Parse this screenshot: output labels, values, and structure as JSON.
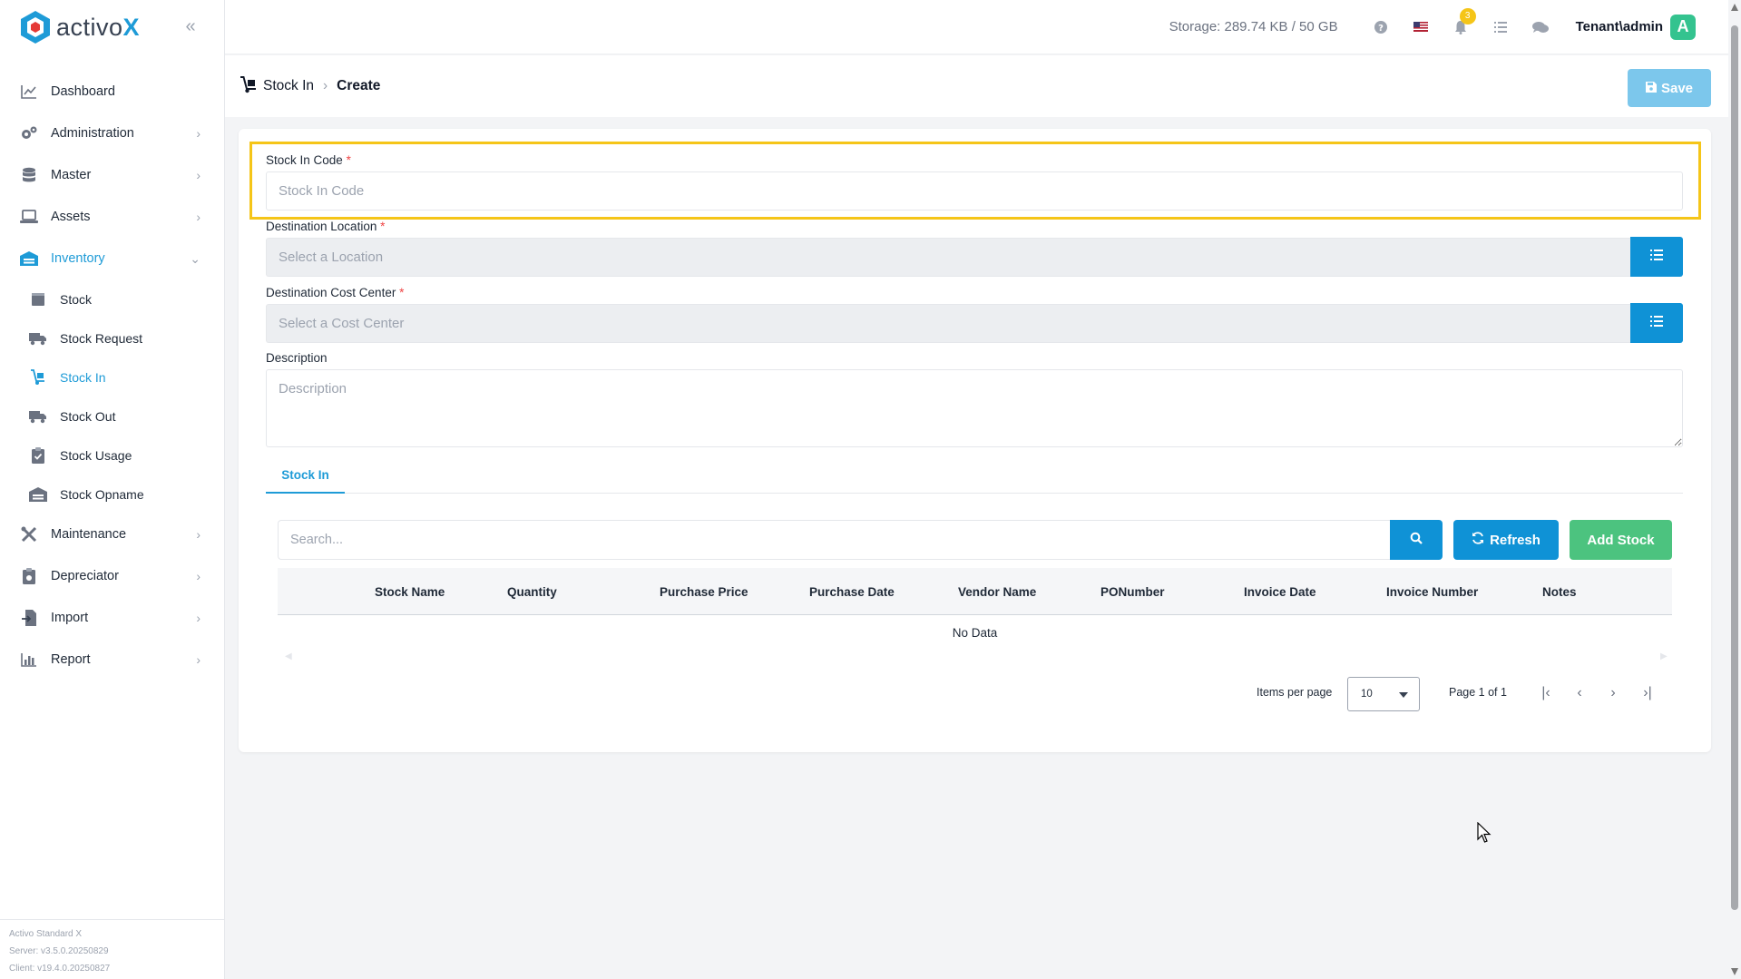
{
  "app": {
    "logo_text": "activo",
    "logo_x": "X",
    "brand_color": "#1e9bd7"
  },
  "sidebar": {
    "items": [
      {
        "label": "Dashboard",
        "icon": "chart-line-icon",
        "has_chevron": false
      },
      {
        "label": "Administration",
        "icon": "gears-icon",
        "has_chevron": true
      },
      {
        "label": "Master",
        "icon": "database-icon",
        "has_chevron": true
      },
      {
        "label": "Assets",
        "icon": "laptop-icon",
        "has_chevron": true
      },
      {
        "label": "Inventory",
        "icon": "warehouse-icon",
        "has_chevron": true,
        "expanded": true
      }
    ],
    "inventory_sub": [
      {
        "label": "Stock",
        "icon": "box-icon"
      },
      {
        "label": "Stock Request",
        "icon": "truck-icon"
      },
      {
        "label": "Stock In",
        "icon": "dolly-icon",
        "active": true
      },
      {
        "label": "Stock Out",
        "icon": "truck-out-icon"
      },
      {
        "label": "Stock Usage",
        "icon": "clipboard-check-icon"
      },
      {
        "label": "Stock Opname",
        "icon": "warehouse-check-icon"
      }
    ],
    "items_after": [
      {
        "label": "Maintenance",
        "icon": "tools-icon"
      },
      {
        "label": "Depreciator",
        "icon": "clipboard-dollar-icon"
      },
      {
        "label": "Import",
        "icon": "file-import-icon"
      },
      {
        "label": "Report",
        "icon": "chart-bar-icon"
      }
    ],
    "footer": {
      "product": "Activo Standard X",
      "server": "Server: v3.5.0.20250829",
      "client": "Client: v19.4.0.20250827"
    }
  },
  "topbar": {
    "storage": "Storage: 289.74 KB / 50 GB",
    "notification_count": "3",
    "user": "Tenant\\admin",
    "avatar_letter": "A"
  },
  "header": {
    "breadcrumb_parent": "Stock In",
    "breadcrumb_current": "Create",
    "save_label": "Save"
  },
  "form": {
    "code_label": "Stock In Code",
    "code_placeholder": "Stock In Code",
    "location_label": "Destination Location",
    "location_placeholder": "Select a Location",
    "cost_center_label": "Destination Cost Center",
    "cost_center_placeholder": "Select a Cost Center",
    "description_label": "Description",
    "description_placeholder": "Description",
    "required_mark": "*"
  },
  "tabs": [
    {
      "label": "Stock In"
    }
  ],
  "grid": {
    "search_placeholder": "Search...",
    "refresh_label": "Refresh",
    "add_label": "Add Stock",
    "columns": [
      "Stock Name",
      "Quantity",
      "Purchase Price",
      "Purchase Date",
      "Vendor Name",
      "PONumber",
      "Invoice Date",
      "Invoice Number",
      "Notes"
    ],
    "empty_text": "No Data",
    "items_per_page_label": "Items per page",
    "items_per_page": "10",
    "page_info": "Page 1 of 1"
  }
}
